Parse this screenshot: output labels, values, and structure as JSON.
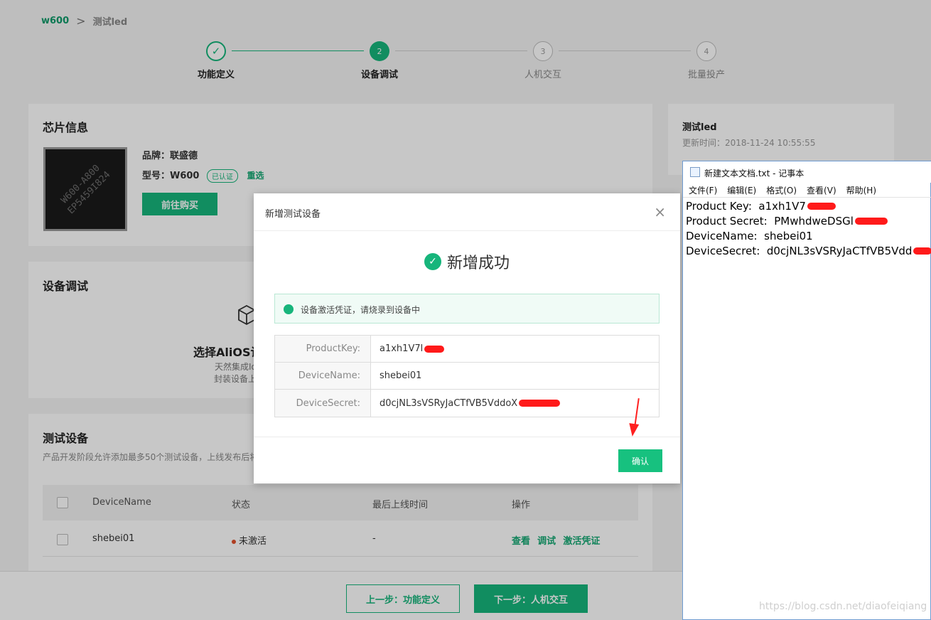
{
  "breadcrumb": {
    "home": "w600",
    "separator": ">",
    "current": "测试led"
  },
  "steps": [
    {
      "num": "✓",
      "label": "功能定义"
    },
    {
      "num": "2",
      "label": "设备调试"
    },
    {
      "num": "3",
      "label": "人机交互"
    },
    {
      "num": "4",
      "label": "批量投产"
    }
  ],
  "chip_card": {
    "title": "芯片信息",
    "chip_image_text": "W600-A800\nEP5459I824",
    "brand_label": "品牌：联盛德",
    "model_label": "型号：W600",
    "certified_tag": "已认证",
    "reselect_link": "重选",
    "buy_button": "前往购买"
  },
  "debug_card": {
    "title": "设备调试",
    "heading": "选择AliOS认",
    "line1": "天然集成Io",
    "line2": "封装设备上"
  },
  "test_devices": {
    "title": "测试设备",
    "subtitle": "产品开发阶段允许添加最多50个测试设备，上线发布后将",
    "columns": [
      "DeviceName",
      "状态",
      "最后上线时间",
      "操作"
    ],
    "rows": [
      {
        "name": "shebei01",
        "status": "未激活",
        "last_online": "-",
        "actions": [
          "查看",
          "调试",
          "激活凭证"
        ]
      }
    ]
  },
  "footer": {
    "prev_button": "上一步：功能定义",
    "next_button": "下一步：人机交互"
  },
  "side_card": {
    "title": "测试led",
    "updated": "更新时间：2018-11-24 10:55:55"
  },
  "modal": {
    "title": "新增测试设备",
    "close": "×",
    "success_text": "新增成功",
    "info_text": "设备激活凭证，请烧录到设备中",
    "credentials": [
      {
        "key": "ProductKey:",
        "value": "a1xh1V7l"
      },
      {
        "key": "DeviceName:",
        "value": "shebei01"
      },
      {
        "key": "DeviceSecret:",
        "value": "d0cjNL3sVSRyJaCTfVB5VddoX"
      }
    ],
    "ok_button": "确认"
  },
  "notepad": {
    "title": "新建文本文档.txt - 记事本",
    "menu": [
      "文件(F)",
      "编辑(E)",
      "格式(O)",
      "查看(V)",
      "帮助(H)"
    ],
    "lines": [
      "Product Key:  a1xh1V7",
      "Product Secret:  PMwhdweDSGl",
      "DeviceName:  shebei01",
      "DeviceSecret:  d0cjNL3sVSRyJaCTfVB5Vdd"
    ]
  },
  "watermark": "https://blog.csdn.net/diaofeiqiang",
  "colors": {
    "accent": "#17b57b",
    "redaction": "#ff1a1a",
    "status_inactive": "#e0502b"
  }
}
